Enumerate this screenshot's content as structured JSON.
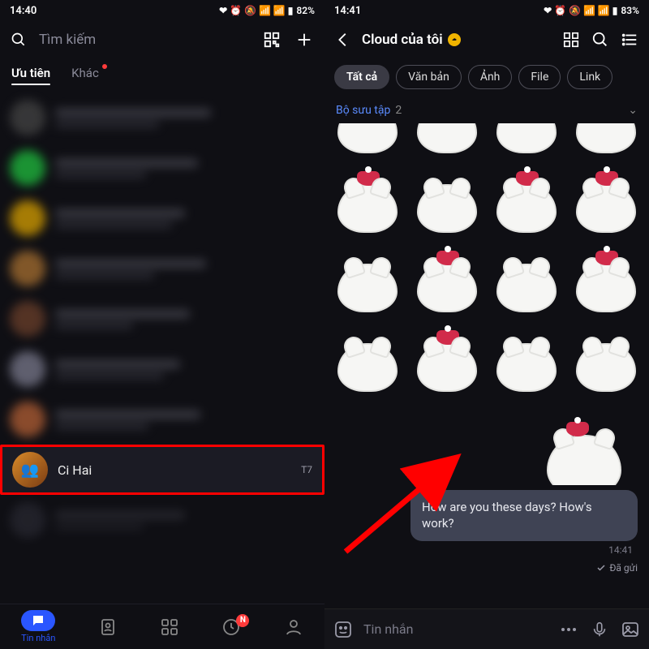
{
  "statusbar_left": {
    "time": "14:40",
    "icons": "❤ ⏰ 🔕 📶 📶 ▮",
    "battery": "82%"
  },
  "statusbar_right": {
    "time": "14:41",
    "icons": "❤ ⏰ 🔕 📶 📶 ▮",
    "battery": "83%"
  },
  "left": {
    "search_placeholder": "Tìm kiếm",
    "tabs": {
      "priority": "Ưu tiên",
      "other": "Khác"
    },
    "highlighted_chat": {
      "name": "Ci Hai",
      "time": "T7"
    },
    "bottom_nav": {
      "messages": "Tin nhắn",
      "badge": "N"
    }
  },
  "right": {
    "title": "Cloud của tôi",
    "filters": [
      "Tất cả",
      "Văn bản",
      "Ảnh",
      "File",
      "Link"
    ],
    "collection_label": "Bộ sưu tập",
    "collection_count": "2",
    "message_text": "How are you these days? How's work?",
    "message_time": "14:41",
    "sent_status": "Đã gửi",
    "input_placeholder": "Tin nhắn"
  }
}
